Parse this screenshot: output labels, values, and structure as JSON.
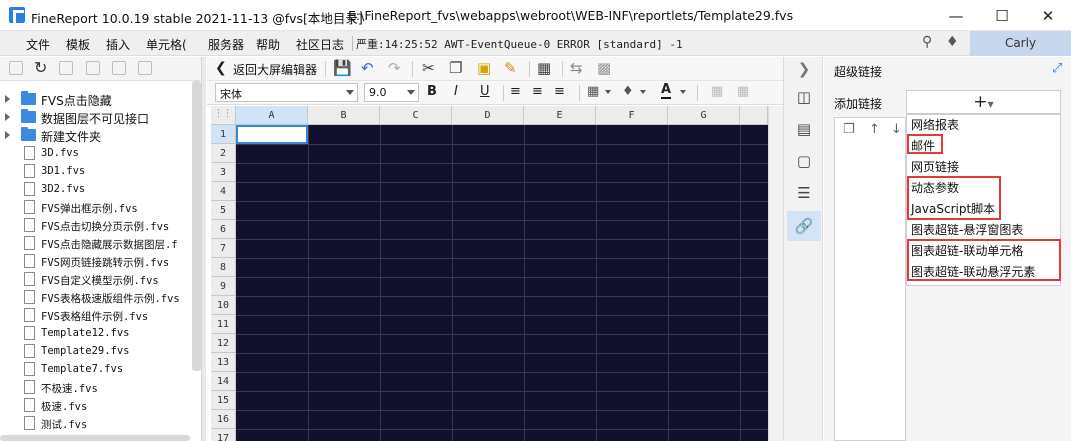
{
  "titlebar": {
    "app_title": "FineReport 10.0.19 stable 2021-11-13 @fvs[本地目录]",
    "file_path": "E:\\FineReport_fvs\\webapps\\webroot\\WEB-INF\\reportlets/Template29.fvs",
    "minimize": "—",
    "maximize": "☐",
    "close": "✕"
  },
  "menubar": {
    "items": [
      "文件",
      "模板",
      "插入",
      "单元格(",
      "服务器",
      "帮助",
      "社区日志"
    ],
    "status_message": "严重:14:25:52 AWT-EventQueue-0 ERROR [standard] -1",
    "user": "Carly"
  },
  "file_panel": {
    "folders": [
      "FVS点击隐藏",
      "数据图层不可见接口",
      "新建文件夹"
    ],
    "files": [
      "3D.fvs",
      "3D1.fvs",
      "3D2.fvs",
      "FVS弹出框示例.fvs",
      "FVS点击切换分页示例.fvs",
      "FVS点击隐藏展示数据图层.f",
      "FVS网页链接跳转示例.fvs",
      "FVS自定义模型示例.fvs",
      "FVS表格极速版组件示例.fvs",
      "FVS表格组件示例.fvs",
      "Template12.fvs",
      "Template29.fvs",
      "Template7.fvs",
      "不极速.fvs",
      "极速.fvs",
      "测试.fvs"
    ]
  },
  "editor": {
    "back_label": "返回大屏编辑器",
    "font_name": "宋体",
    "font_size": "9.0",
    "columns": [
      "A",
      "B",
      "C",
      "D",
      "E",
      "F",
      "G"
    ],
    "rows": [
      "1",
      "2",
      "3",
      "4",
      "5",
      "6",
      "7",
      "8",
      "9",
      "10",
      "11",
      "12",
      "13",
      "14",
      "15",
      "16",
      "17"
    ],
    "grid_background": "#12102a",
    "selection_color": "#3b86d8"
  },
  "hyperlink_panel": {
    "title": "超级链接",
    "add_label": "添加链接",
    "add_button": "+",
    "options": [
      "网络报表",
      "邮件",
      "网页链接",
      "动态参数",
      "JavaScript脚本",
      "图表超链-悬浮窗图表",
      "图表超链-联动单元格",
      "图表超链-联动悬浮元素"
    ],
    "highlight_color": "#e23a3a"
  }
}
